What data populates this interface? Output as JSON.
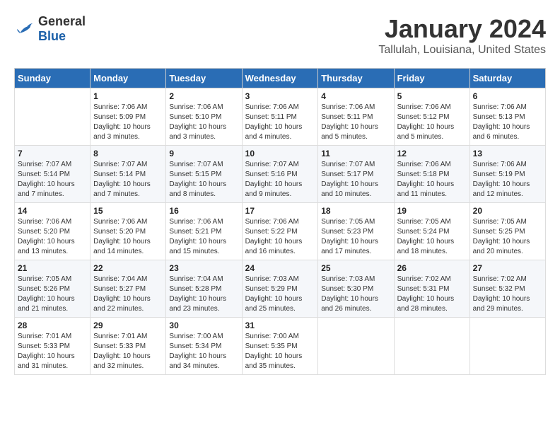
{
  "logo": {
    "text_general": "General",
    "text_blue": "Blue"
  },
  "title": {
    "month_year": "January 2024",
    "location": "Tallulah, Louisiana, United States"
  },
  "headers": [
    "Sunday",
    "Monday",
    "Tuesday",
    "Wednesday",
    "Thursday",
    "Friday",
    "Saturday"
  ],
  "weeks": [
    [
      {
        "day": "",
        "info": ""
      },
      {
        "day": "1",
        "info": "Sunrise: 7:06 AM\nSunset: 5:09 PM\nDaylight: 10 hours\nand 3 minutes."
      },
      {
        "day": "2",
        "info": "Sunrise: 7:06 AM\nSunset: 5:10 PM\nDaylight: 10 hours\nand 3 minutes."
      },
      {
        "day": "3",
        "info": "Sunrise: 7:06 AM\nSunset: 5:11 PM\nDaylight: 10 hours\nand 4 minutes."
      },
      {
        "day": "4",
        "info": "Sunrise: 7:06 AM\nSunset: 5:11 PM\nDaylight: 10 hours\nand 5 minutes."
      },
      {
        "day": "5",
        "info": "Sunrise: 7:06 AM\nSunset: 5:12 PM\nDaylight: 10 hours\nand 5 minutes."
      },
      {
        "day": "6",
        "info": "Sunrise: 7:06 AM\nSunset: 5:13 PM\nDaylight: 10 hours\nand 6 minutes."
      }
    ],
    [
      {
        "day": "7",
        "info": "Sunrise: 7:07 AM\nSunset: 5:14 PM\nDaylight: 10 hours\nand 7 minutes."
      },
      {
        "day": "8",
        "info": "Sunrise: 7:07 AM\nSunset: 5:14 PM\nDaylight: 10 hours\nand 7 minutes."
      },
      {
        "day": "9",
        "info": "Sunrise: 7:07 AM\nSunset: 5:15 PM\nDaylight: 10 hours\nand 8 minutes."
      },
      {
        "day": "10",
        "info": "Sunrise: 7:07 AM\nSunset: 5:16 PM\nDaylight: 10 hours\nand 9 minutes."
      },
      {
        "day": "11",
        "info": "Sunrise: 7:07 AM\nSunset: 5:17 PM\nDaylight: 10 hours\nand 10 minutes."
      },
      {
        "day": "12",
        "info": "Sunrise: 7:06 AM\nSunset: 5:18 PM\nDaylight: 10 hours\nand 11 minutes."
      },
      {
        "day": "13",
        "info": "Sunrise: 7:06 AM\nSunset: 5:19 PM\nDaylight: 10 hours\nand 12 minutes."
      }
    ],
    [
      {
        "day": "14",
        "info": "Sunrise: 7:06 AM\nSunset: 5:20 PM\nDaylight: 10 hours\nand 13 minutes."
      },
      {
        "day": "15",
        "info": "Sunrise: 7:06 AM\nSunset: 5:20 PM\nDaylight: 10 hours\nand 14 minutes."
      },
      {
        "day": "16",
        "info": "Sunrise: 7:06 AM\nSunset: 5:21 PM\nDaylight: 10 hours\nand 15 minutes."
      },
      {
        "day": "17",
        "info": "Sunrise: 7:06 AM\nSunset: 5:22 PM\nDaylight: 10 hours\nand 16 minutes."
      },
      {
        "day": "18",
        "info": "Sunrise: 7:05 AM\nSunset: 5:23 PM\nDaylight: 10 hours\nand 17 minutes."
      },
      {
        "day": "19",
        "info": "Sunrise: 7:05 AM\nSunset: 5:24 PM\nDaylight: 10 hours\nand 18 minutes."
      },
      {
        "day": "20",
        "info": "Sunrise: 7:05 AM\nSunset: 5:25 PM\nDaylight: 10 hours\nand 20 minutes."
      }
    ],
    [
      {
        "day": "21",
        "info": "Sunrise: 7:05 AM\nSunset: 5:26 PM\nDaylight: 10 hours\nand 21 minutes."
      },
      {
        "day": "22",
        "info": "Sunrise: 7:04 AM\nSunset: 5:27 PM\nDaylight: 10 hours\nand 22 minutes."
      },
      {
        "day": "23",
        "info": "Sunrise: 7:04 AM\nSunset: 5:28 PM\nDaylight: 10 hours\nand 23 minutes."
      },
      {
        "day": "24",
        "info": "Sunrise: 7:03 AM\nSunset: 5:29 PM\nDaylight: 10 hours\nand 25 minutes."
      },
      {
        "day": "25",
        "info": "Sunrise: 7:03 AM\nSunset: 5:30 PM\nDaylight: 10 hours\nand 26 minutes."
      },
      {
        "day": "26",
        "info": "Sunrise: 7:02 AM\nSunset: 5:31 PM\nDaylight: 10 hours\nand 28 minutes."
      },
      {
        "day": "27",
        "info": "Sunrise: 7:02 AM\nSunset: 5:32 PM\nDaylight: 10 hours\nand 29 minutes."
      }
    ],
    [
      {
        "day": "28",
        "info": "Sunrise: 7:01 AM\nSunset: 5:33 PM\nDaylight: 10 hours\nand 31 minutes."
      },
      {
        "day": "29",
        "info": "Sunrise: 7:01 AM\nSunset: 5:33 PM\nDaylight: 10 hours\nand 32 minutes."
      },
      {
        "day": "30",
        "info": "Sunrise: 7:00 AM\nSunset: 5:34 PM\nDaylight: 10 hours\nand 34 minutes."
      },
      {
        "day": "31",
        "info": "Sunrise: 7:00 AM\nSunset: 5:35 PM\nDaylight: 10 hours\nand 35 minutes."
      },
      {
        "day": "",
        "info": ""
      },
      {
        "day": "",
        "info": ""
      },
      {
        "day": "",
        "info": ""
      }
    ]
  ]
}
